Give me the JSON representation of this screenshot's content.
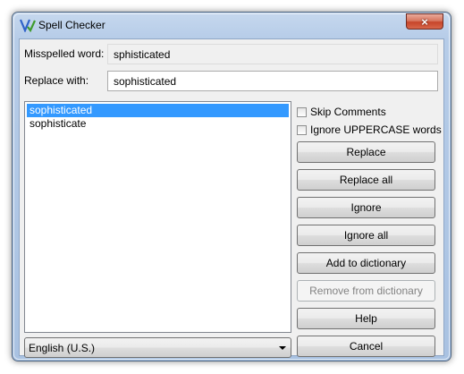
{
  "window": {
    "title": "Spell Checker",
    "close_glyph": "×"
  },
  "misspelled": {
    "label": "Misspelled word:",
    "value": "sphisticated"
  },
  "replace_with": {
    "label": "Replace with:",
    "value": "sophisticated"
  },
  "suggestions": [
    {
      "text": "sophisticated",
      "selected": true
    },
    {
      "text": "sophisticate",
      "selected": false
    }
  ],
  "options": {
    "skip_comments": {
      "label": "Skip Comments",
      "checked": false
    },
    "ignore_uppercase": {
      "label": "Ignore UPPERCASE words",
      "checked": false
    }
  },
  "buttons": {
    "replace": "Replace",
    "replace_all": "Replace all",
    "ignore": "Ignore",
    "ignore_all": "Ignore all",
    "add_to_dictionary": "Add to dictionary",
    "remove_from_dictionary": "Remove from dictionary",
    "help": "Help",
    "cancel": "Cancel"
  },
  "language": {
    "selected": "English (U.S.)"
  },
  "icons": {
    "app": "spell-check-icon",
    "close": "close-icon",
    "dropdown": "chevron-down-icon"
  }
}
